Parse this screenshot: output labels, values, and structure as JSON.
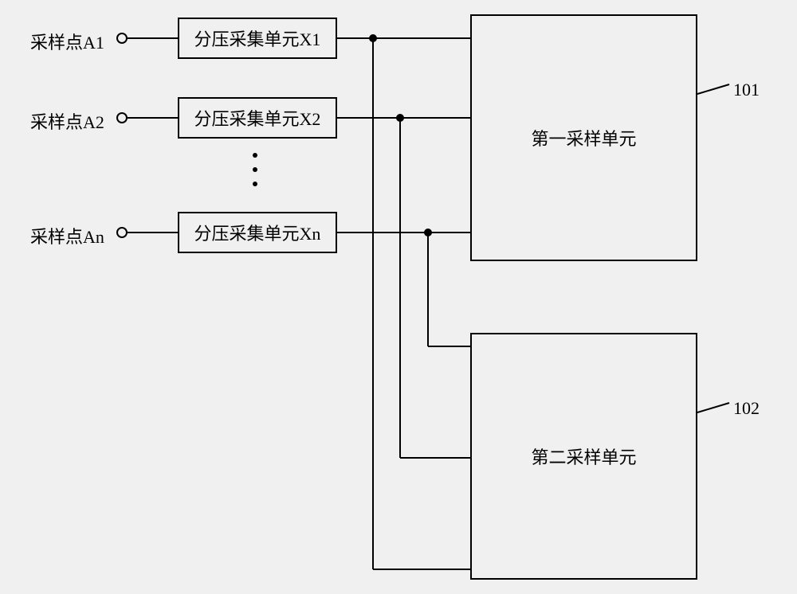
{
  "sampling_points": [
    {
      "label": "采样点A1"
    },
    {
      "label": "采样点A2"
    },
    {
      "label": "采样点An"
    }
  ],
  "dividers": [
    {
      "label": "分压采集单元X1"
    },
    {
      "label": "分压采集单元X2"
    },
    {
      "label": "分压采集单元Xn"
    }
  ],
  "sampling_units": {
    "first": {
      "label": "第一采样单元",
      "ref": "101"
    },
    "second": {
      "label": "第二采样单元",
      "ref": "102"
    }
  }
}
